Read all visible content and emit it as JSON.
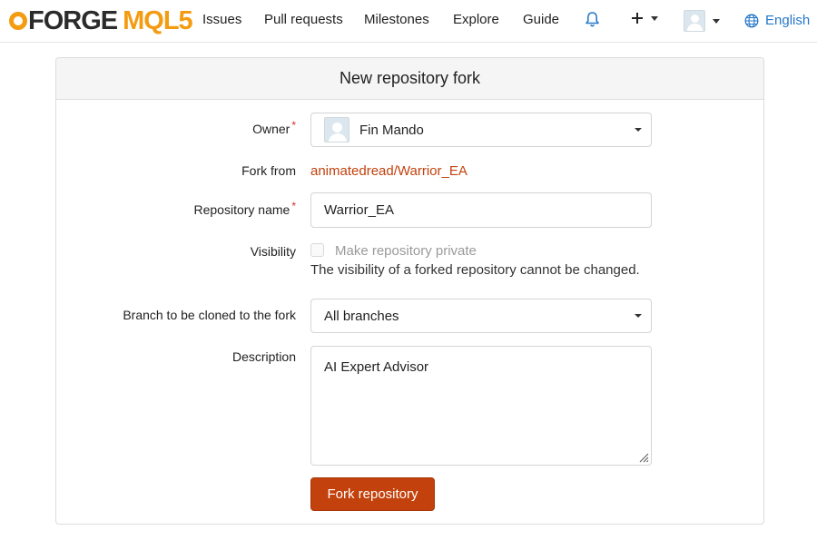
{
  "nav": {
    "logo_forge": "FORGE",
    "logo_mql": "MQL5",
    "items": [
      "Issues",
      "Pull requests",
      "Milestones",
      "Explore",
      "Guide"
    ],
    "language": "English"
  },
  "form": {
    "title": "New repository fork",
    "owner": {
      "label": "Owner",
      "required": "*",
      "value": "Fin Mando"
    },
    "fork_from": {
      "label": "Fork from",
      "value": "animatedread/Warrior_EA"
    },
    "repo_name": {
      "label": "Repository name",
      "required": "*",
      "value": "Warrior_EA"
    },
    "visibility": {
      "label": "Visibility",
      "checkbox_label": "Make repository private",
      "help": "The visibility of a forked repository cannot be changed."
    },
    "branch": {
      "label": "Branch to be cloned to the fork",
      "value": "All branches"
    },
    "description": {
      "label": "Description",
      "value": "AI Expert Advisor"
    },
    "submit_label": "Fork repository"
  },
  "colors": {
    "accent": "#c2410c",
    "link": "#2677c9",
    "logo_orange": "#f39c12"
  }
}
